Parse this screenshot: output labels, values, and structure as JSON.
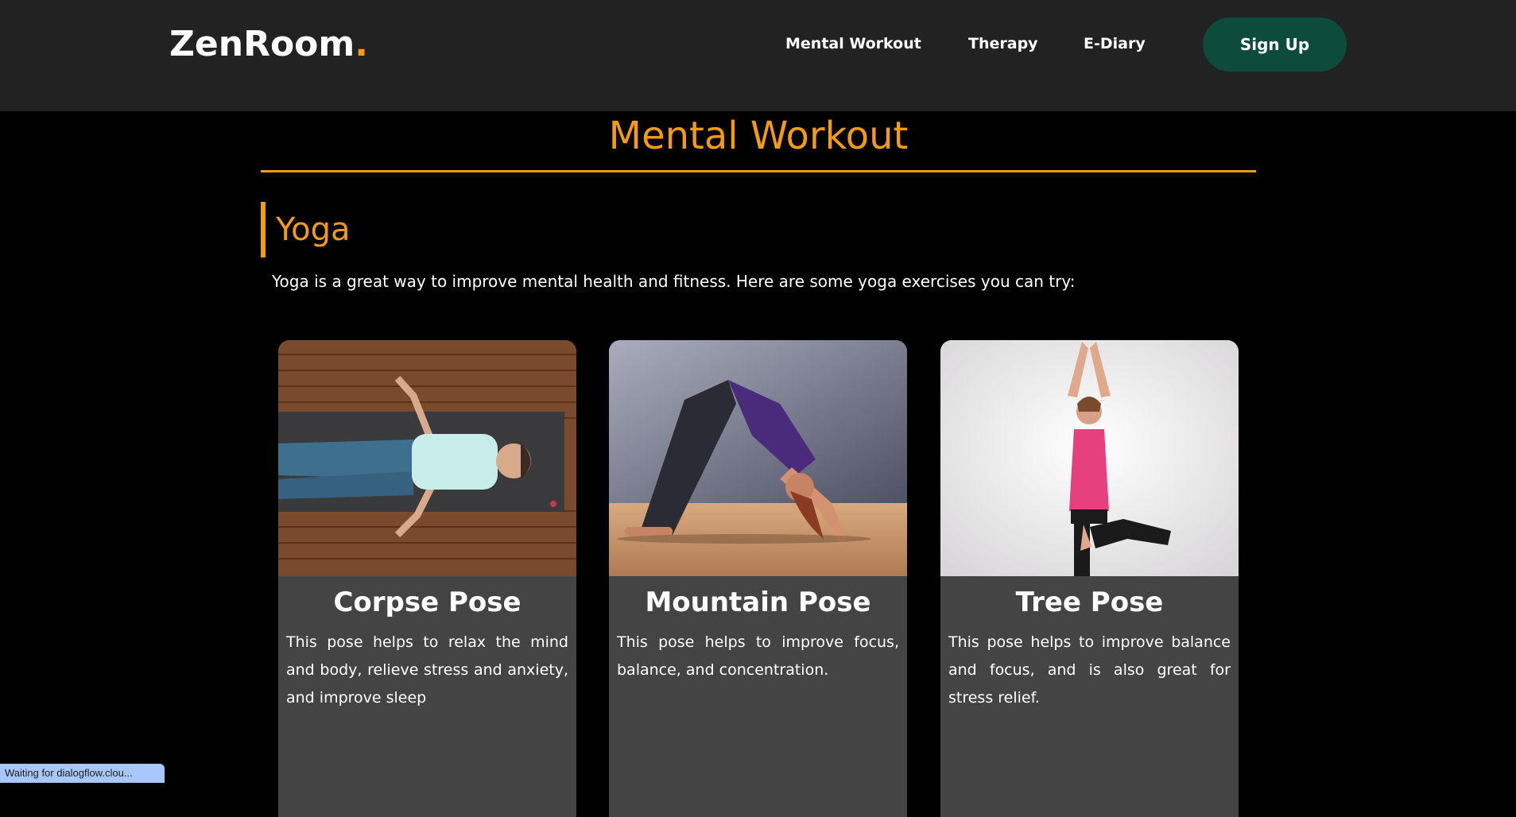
{
  "nav": {
    "logo_text": "ZenRoom",
    "logo_dot": ".",
    "links": [
      "Mental Workout",
      "Therapy",
      "E-Diary"
    ],
    "signup_label": "Sign Up"
  },
  "page": {
    "title": "Mental Workout",
    "section_title": "Yoga",
    "intro": "Yoga is a great way to improve mental health and fitness. Here are some yoga exercises you can try:"
  },
  "cards": [
    {
      "title": "Corpse Pose",
      "text": "This pose helps to relax the mind and body, relieve stress and anxiety, and improve sleep",
      "image": "woman-lying-on-yoga-mat-photo"
    },
    {
      "title": "Mountain Pose",
      "text": "This pose helps to improve focus, balance, and concentration.",
      "image": "woman-downward-dog-photo"
    },
    {
      "title": "Tree Pose",
      "text": "This pose helps to improve balance and focus, and is also great for stress relief.",
      "image": "woman-tree-pose-photo"
    }
  ],
  "status": {
    "text": "Waiting for dialogflow.clou..."
  },
  "colors": {
    "accent": "#f39c12",
    "nav_bg": "#222222",
    "signup_bg": "#0d4c3d",
    "card_bg": "#444444",
    "page_bg": "#000000"
  }
}
